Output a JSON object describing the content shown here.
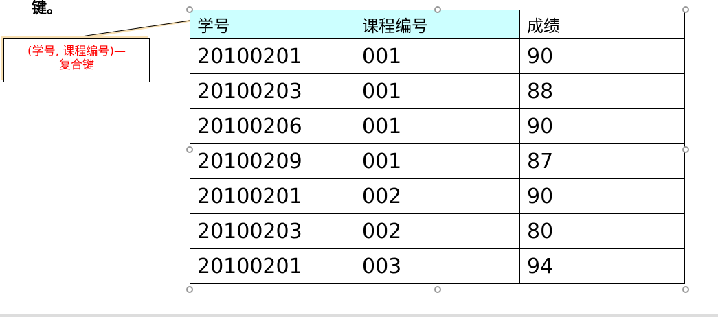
{
  "top_text": "键。",
  "callout": {
    "line1": "(学号, 课程编号)—",
    "line2": "复合键",
    "color": "#ff0000"
  },
  "table": {
    "headers": [
      "学号",
      "课程编号",
      "成绩"
    ],
    "header_bg": "#ccffff",
    "rows": [
      [
        "20100201",
        "001",
        "90"
      ],
      [
        "20100203",
        "001",
        "88"
      ],
      [
        "20100206",
        "001",
        "90"
      ],
      [
        "20100209",
        "001",
        "87"
      ],
      [
        "20100201",
        "002",
        "90"
      ],
      [
        "20100203",
        "002",
        "80"
      ],
      [
        "20100201",
        "003",
        "94"
      ]
    ]
  }
}
